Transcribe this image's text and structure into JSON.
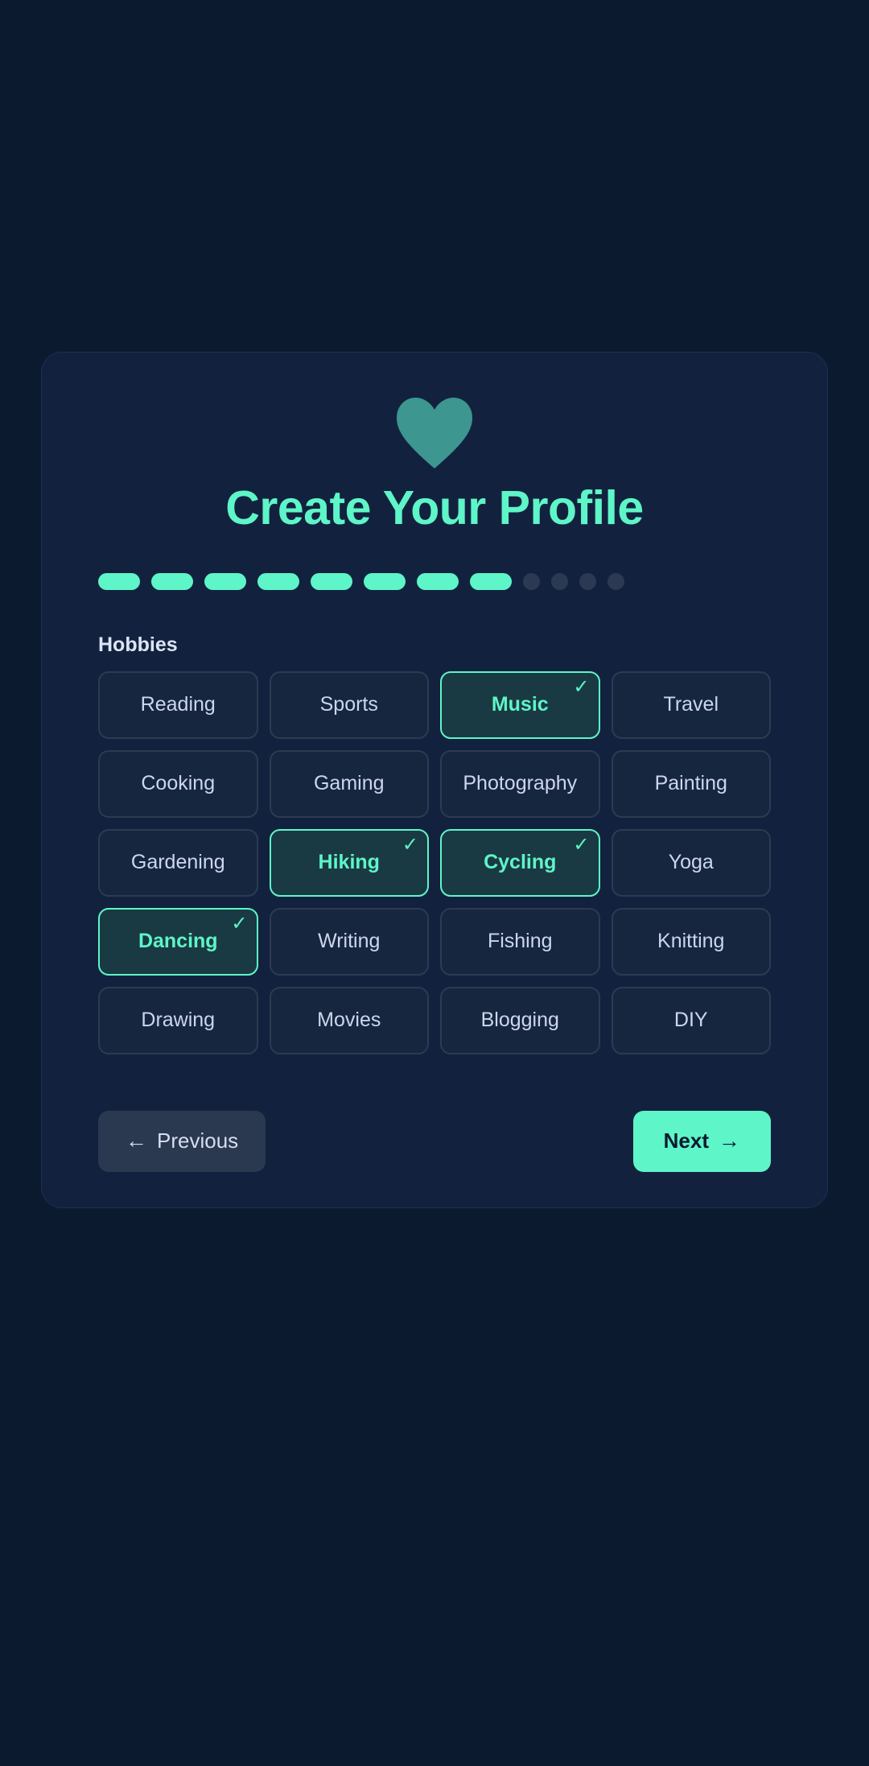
{
  "app": {
    "background_color": "#0b1a2e",
    "card_color": "#12223e",
    "accent_color": "#5ef5c8",
    "heart_icon_color": "#3d9690"
  },
  "header": {
    "icon": "heart-icon",
    "title": "Create Your Profile"
  },
  "progress": {
    "total_steps": 12,
    "completed_steps": 8,
    "active_color": "#5ef5c8",
    "inactive_color": "#2b3a52"
  },
  "section": {
    "label": "Hobbies"
  },
  "hobbies": [
    {
      "label": "Reading",
      "selected": false
    },
    {
      "label": "Sports",
      "selected": false
    },
    {
      "label": "Music",
      "selected": true
    },
    {
      "label": "Travel",
      "selected": false
    },
    {
      "label": "Cooking",
      "selected": false
    },
    {
      "label": "Gaming",
      "selected": false
    },
    {
      "label": "Photography",
      "selected": false
    },
    {
      "label": "Painting",
      "selected": false
    },
    {
      "label": "Gardening",
      "selected": false
    },
    {
      "label": "Hiking",
      "selected": true
    },
    {
      "label": "Cycling",
      "selected": true
    },
    {
      "label": "Yoga",
      "selected": false
    },
    {
      "label": "Dancing",
      "selected": true
    },
    {
      "label": "Writing",
      "selected": false
    },
    {
      "label": "Fishing",
      "selected": false
    },
    {
      "label": "Knitting",
      "selected": false
    },
    {
      "label": "Drawing",
      "selected": false
    },
    {
      "label": "Movies",
      "selected": false
    },
    {
      "label": "Blogging",
      "selected": false
    },
    {
      "label": "DIY",
      "selected": false
    }
  ],
  "selection_check_glyph": "✓",
  "nav": {
    "previous_label": "Previous",
    "previous_arrow": "←",
    "next_label": "Next",
    "next_arrow": "→"
  }
}
